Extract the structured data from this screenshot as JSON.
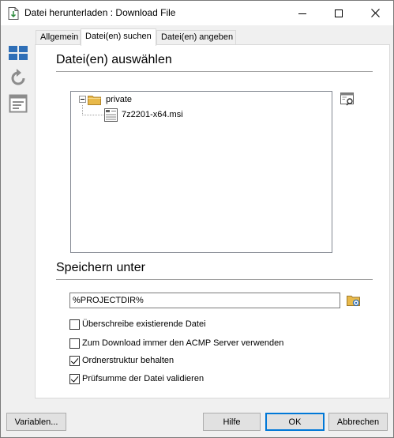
{
  "window": {
    "title": "Datei herunterladen : Download File"
  },
  "tabs": [
    {
      "label": "Allgemein"
    },
    {
      "label": "Datei(en) suchen"
    },
    {
      "label": "Datei(en) angeben"
    }
  ],
  "select_section": {
    "title": "Datei(en) auswählen",
    "tree": {
      "folder": "private",
      "file": "7z2201-x64.msi"
    }
  },
  "save_section": {
    "title": "Speichern unter",
    "path_value": "%PROJECTDIR%"
  },
  "options": [
    {
      "label": "Überschreibe existierende Datei",
      "checked": false
    },
    {
      "label": "Zum Download immer den ACMP Server verwenden",
      "checked": false
    },
    {
      "label": "Ordnerstruktur behalten",
      "checked": true
    },
    {
      "label": "Prüfsumme der Datei validieren",
      "checked": true
    }
  ],
  "buttons": {
    "variables": "Variablen...",
    "help": "Hilfe",
    "ok": "OK",
    "cancel": "Abbrechen"
  },
  "colors": {
    "accent": "#0078d7",
    "tile_blue": "#2f6fb7",
    "icon_gray": "#8c8c8c",
    "folder": "#e8b94a"
  }
}
